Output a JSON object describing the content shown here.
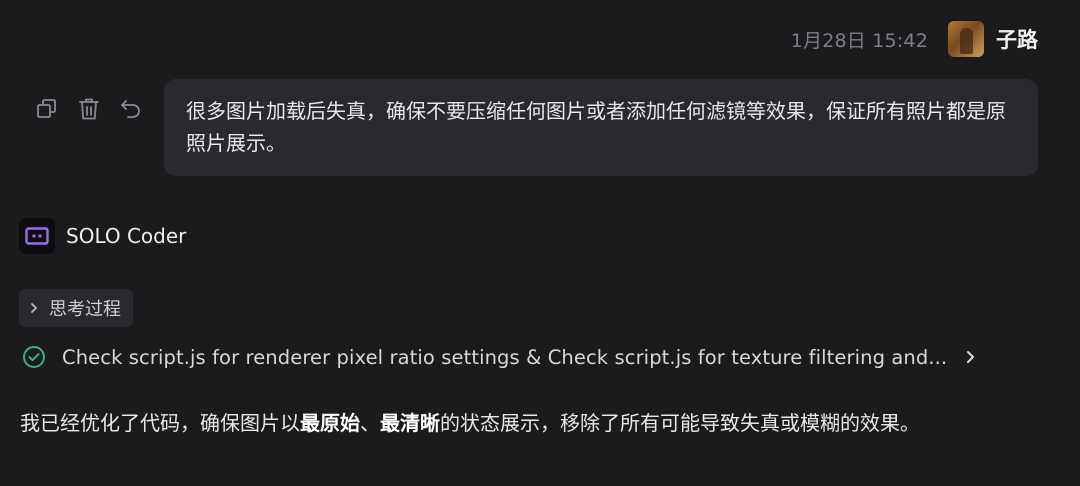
{
  "header": {
    "timestamp": "1月28日 15:42",
    "username": "子路"
  },
  "actions": {
    "copy_icon": "copy-icon",
    "delete_icon": "trash-icon",
    "undo_icon": "undo-icon"
  },
  "user_message": {
    "text": "很多图片加载后失真，确保不要压缩任何图片或者添加任何滤镜等效果，保证所有照片都是原照片展示。"
  },
  "agent": {
    "name": "SOLO Coder",
    "thinking_label": "思考过程",
    "task_text": "Check script.js for renderer pixel ratio settings & Check script.js for texture filtering and..."
  },
  "response": {
    "part1": "我已经优化了代码，确保图片以",
    "bold1": "最原始",
    "sep": "、",
    "bold2": "最清晰",
    "part2": "的状态展示，移除了所有可能导致失真或模糊的效果。"
  },
  "colors": {
    "background": "#1b1b1d",
    "bubble": "#2a2a2e",
    "accent_purple": "#9a6cf2",
    "success_green": "#36b37e"
  }
}
